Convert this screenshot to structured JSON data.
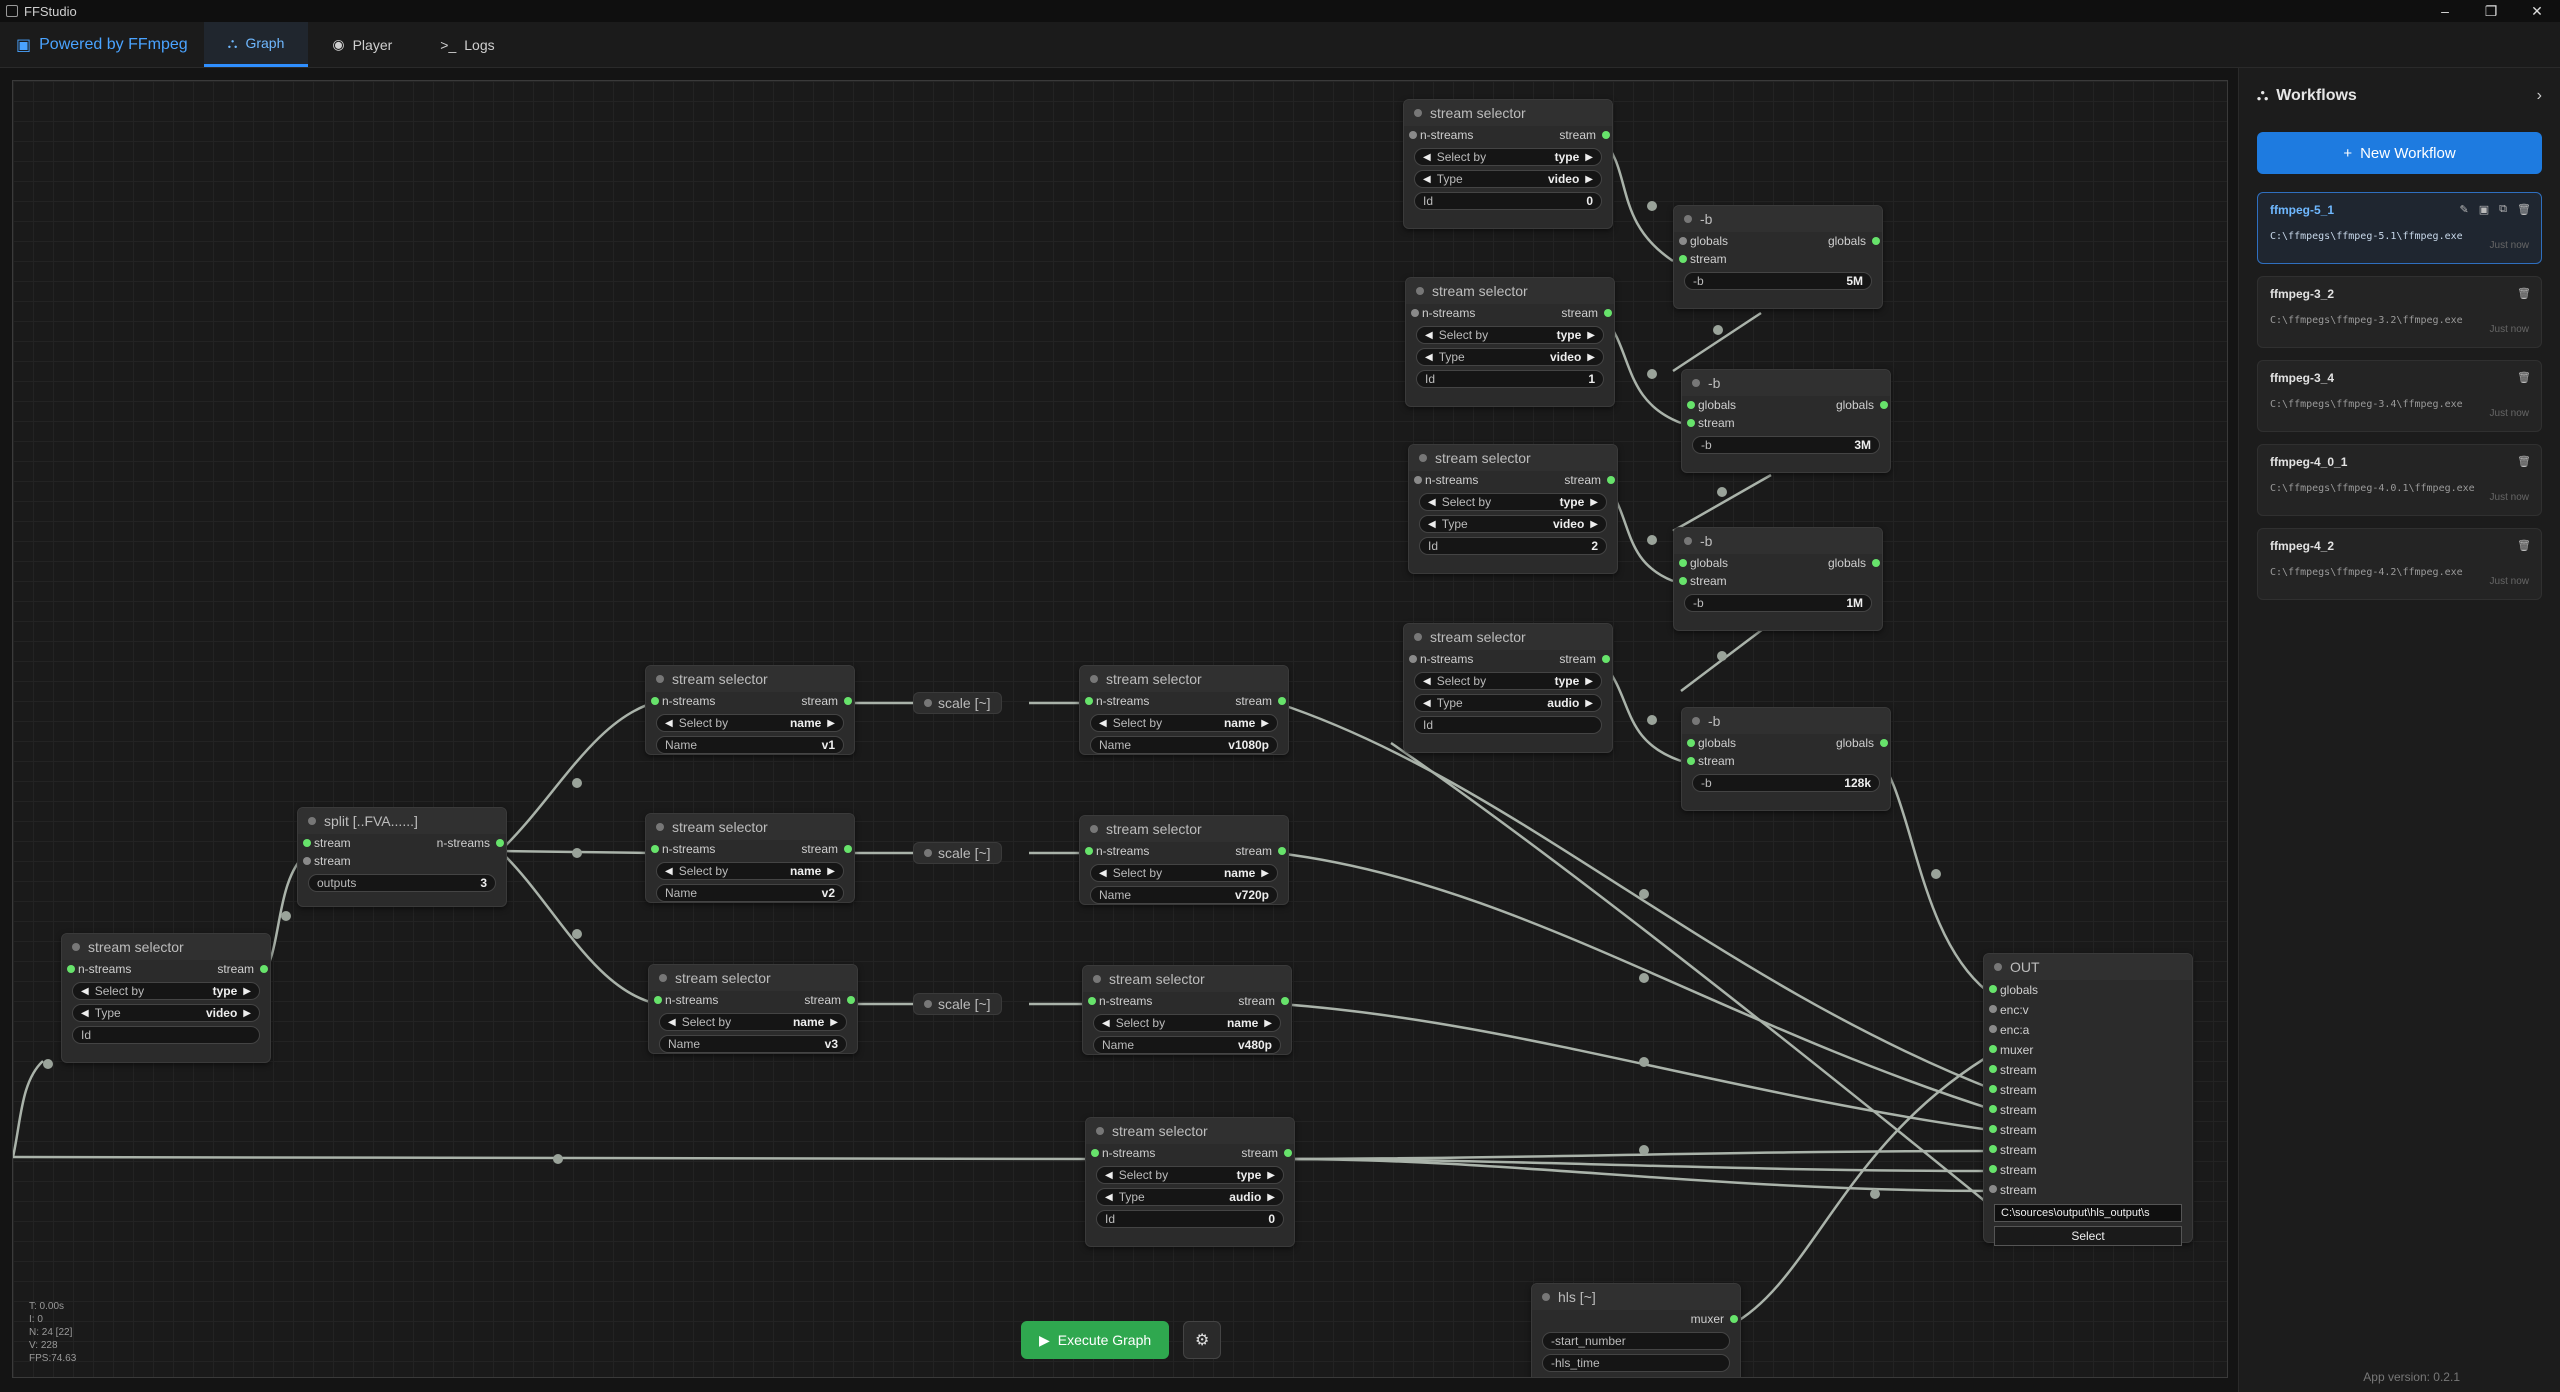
{
  "window": {
    "title": "FFStudio",
    "minimize": "–",
    "maximize": "❐",
    "close": "✕"
  },
  "tabs": {
    "brand": "Powered by FFmpeg",
    "graph": "Graph",
    "player": "Player",
    "logs": "Logs"
  },
  "nodes": {
    "ss_bottomleft": {
      "title": "stream selector",
      "in": "n-streams",
      "out": "stream",
      "select_by": "Select by",
      "select_val": "type",
      "type_label": "Type",
      "type_val": "video",
      "id_label": "Id",
      "id_val": ""
    },
    "split": {
      "title": "split [..FVA......]",
      "in1": "stream",
      "in2": "stream",
      "out": "n-streams",
      "outputs_label": "outputs",
      "outputs_val": "3"
    },
    "ss_v1": {
      "title": "stream selector",
      "in": "n-streams",
      "out": "stream",
      "select_by": "Select by",
      "select_val": "name",
      "name_label": "Name",
      "name_val": "v1"
    },
    "ss_v2": {
      "title": "stream selector",
      "in": "n-streams",
      "out": "stream",
      "select_by": "Select by",
      "select_val": "name",
      "name_label": "Name",
      "name_val": "v2"
    },
    "ss_v3": {
      "title": "stream selector",
      "in": "n-streams",
      "out": "stream",
      "select_by": "Select by",
      "select_val": "name",
      "name_label": "Name",
      "name_val": "v3"
    },
    "scale": "scale [~]",
    "ss_1080": {
      "title": "stream selector",
      "in": "n-streams",
      "out": "stream",
      "select_by": "Select by",
      "select_val": "name",
      "name_label": "Name",
      "name_val": "v1080p"
    },
    "ss_720": {
      "title": "stream selector",
      "in": "n-streams",
      "out": "stream",
      "select_by": "Select by",
      "select_val": "name",
      "name_label": "Name",
      "name_val": "v720p"
    },
    "ss_480": {
      "title": "stream selector",
      "in": "n-streams",
      "out": "stream",
      "select_by": "Select by",
      "select_val": "name",
      "name_label": "Name",
      "name_val": "v480p"
    },
    "ss_audio_bottom": {
      "title": "stream selector",
      "in": "n-streams",
      "out": "stream",
      "select_by": "Select by",
      "select_val": "type",
      "type_label": "Type",
      "type_val": "audio",
      "id_label": "Id",
      "id_val": "0"
    },
    "ss_t0": {
      "title": "stream selector",
      "in": "n-streams",
      "out": "stream",
      "select_by": "Select by",
      "select_val": "type",
      "type_label": "Type",
      "type_val": "video",
      "id_label": "Id",
      "id_val": "0"
    },
    "ss_t1": {
      "title": "stream selector",
      "in": "n-streams",
      "out": "stream",
      "select_by": "Select by",
      "select_val": "type",
      "type_label": "Type",
      "type_val": "video",
      "id_label": "Id",
      "id_val": "1"
    },
    "ss_t2": {
      "title": "stream selector",
      "in": "n-streams",
      "out": "stream",
      "select_by": "Select by",
      "select_val": "type",
      "type_label": "Type",
      "type_val": "video",
      "id_label": "Id",
      "id_val": "2"
    },
    "ss_t3": {
      "title": "stream selector",
      "in": "n-streams",
      "out": "stream",
      "select_by": "Select by",
      "select_val": "type",
      "type_label": "Type",
      "type_val": "audio",
      "id_label": "Id",
      "id_val": ""
    },
    "b1": {
      "title": "-b",
      "in1": "globals",
      "in2": "stream",
      "out": "globals",
      "label": "-b",
      "val": "5M"
    },
    "b2": {
      "title": "-b",
      "in1": "globals",
      "in2": "stream",
      "out": "globals",
      "label": "-b",
      "val": "3M"
    },
    "b3": {
      "title": "-b",
      "in1": "globals",
      "in2": "stream",
      "out": "globals",
      "label": "-b",
      "val": "1M"
    },
    "b4": {
      "title": "-b",
      "in1": "globals",
      "in2": "stream",
      "out": "globals",
      "label": "-b",
      "val": "128k"
    },
    "out": {
      "title": "OUT",
      "inputs": [
        "globals",
        "enc:v",
        "enc:a",
        "muxer",
        "stream",
        "stream",
        "stream",
        "stream",
        "stream",
        "stream",
        "stream"
      ],
      "path": "C:\\sources\\output\\hls_output\\s",
      "select": "Select"
    },
    "hls": {
      "title": "hls [~]",
      "out": "muxer",
      "f1": "-start_number",
      "f2": "-hls_time"
    }
  },
  "stats": {
    "t": "T: 0.00s",
    "i": "I: 0",
    "n": "N: 24 [22]",
    "v": "V: 228",
    "fps": "FPS:74.63"
  },
  "exec": {
    "label": "Execute Graph",
    "settings_icon": "⚙"
  },
  "sidebar": {
    "title": "Workflows",
    "new_label": "New Workflow",
    "items": [
      {
        "name": "ffmpeg-5_1",
        "path": "C:\\ffmpegs\\ffmpeg-5.1\\ffmpeg.exe",
        "time": "Just now"
      },
      {
        "name": "ffmpeg-3_2",
        "path": "C:\\ffmpegs\\ffmpeg-3.2\\ffmpeg.exe",
        "time": "Just now"
      },
      {
        "name": "ffmpeg-3_4",
        "path": "C:\\ffmpegs\\ffmpeg-3.4\\ffmpeg.exe",
        "time": "Just now"
      },
      {
        "name": "ffmpeg-4_0_1",
        "path": "C:\\ffmpegs\\ffmpeg-4.0.1\\ffmpeg.exe",
        "time": "Just now"
      },
      {
        "name": "ffmpeg-4_2",
        "path": "C:\\ffmpegs\\ffmpeg-4.2\\ffmpeg.exe",
        "time": "Just now"
      }
    ],
    "version": "App version: 0.2.1"
  },
  "colors": {
    "accent": "#2f8fff",
    "slot": "#67e36b",
    "execute": "#2fa84f",
    "new_workflow": "#1e7be0"
  }
}
